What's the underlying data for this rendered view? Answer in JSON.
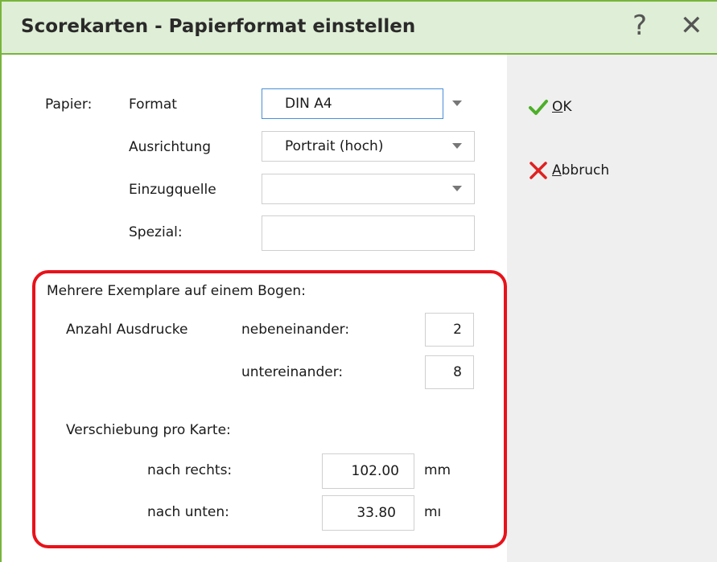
{
  "window": {
    "title": "Scorekarten - Papierformat einstellen",
    "help_glyph": "?",
    "close_glyph": "✕"
  },
  "paper": {
    "section_label": "Papier:",
    "format_label": "Format",
    "format_value": "DIN A4",
    "orientation_label": "Ausrichtung",
    "orientation_value": "Portrait (hoch)",
    "source_label": "Einzugquelle",
    "source_value": "",
    "special_label": "Spezial:",
    "special_value": ""
  },
  "multi": {
    "title": "Mehrere Exemplare auf einem Bogen:",
    "count_label": "Anzahl Ausdrucke",
    "side_by_side_label": "nebeneinander:",
    "side_by_side_value": "2",
    "stacked_label": "untereinander:",
    "stacked_value": "8",
    "offset_title": "Verschiebung pro Karte:",
    "right_label": "nach rechts:",
    "right_value": "102.00",
    "right_unit": "mm",
    "down_label": "nach unten:",
    "down_value": "33.80",
    "down_unit": "mı"
  },
  "actions": {
    "ok_prefix": "O",
    "ok_rest": "K",
    "cancel_prefix": "A",
    "cancel_rest": "bbruch"
  },
  "colors": {
    "accent_green": "#78b43c",
    "titlebar_bg": "#dfeed6",
    "highlight_red": "#e8121a",
    "focus_blue": "#4a8fd8"
  }
}
